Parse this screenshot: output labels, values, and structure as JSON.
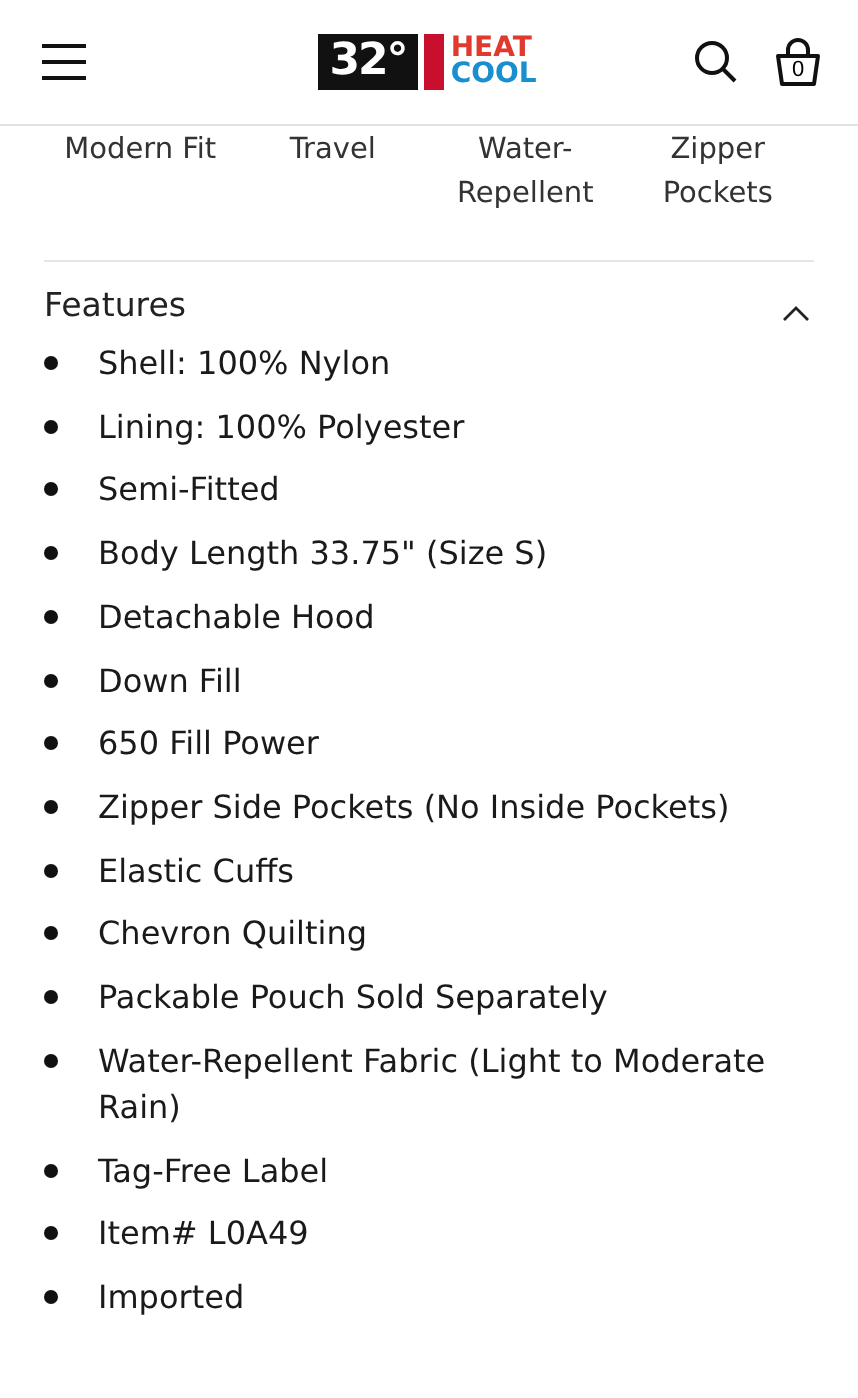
{
  "header": {
    "logo": {
      "badge": "32°",
      "top": "HEAT",
      "bottom": "COOL"
    },
    "cart_count": "0"
  },
  "highlights": [
    {
      "label": "Modern Fit"
    },
    {
      "label": "Travel"
    },
    {
      "label": "Water-\nRepellent"
    },
    {
      "label": "Zipper\nPockets"
    }
  ],
  "features": {
    "title": "Features",
    "expanded": true,
    "items": [
      "Shell: 100% Nylon",
      "Lining: 100% Polyester",
      "Semi-Fitted",
      "Body Length 33.75\" (Size S)",
      "Detachable Hood",
      "Down Fill",
      "650 Fill Power",
      "Zipper Side Pockets (No Inside Pockets)",
      "Elastic Cuffs",
      "Chevron Quilting",
      "Packable Pouch Sold Separately",
      "Water-Repellent Fabric (Light to Moderate Rain)",
      "Tag-Free Label",
      "Item# L0A49",
      "Imported"
    ]
  }
}
